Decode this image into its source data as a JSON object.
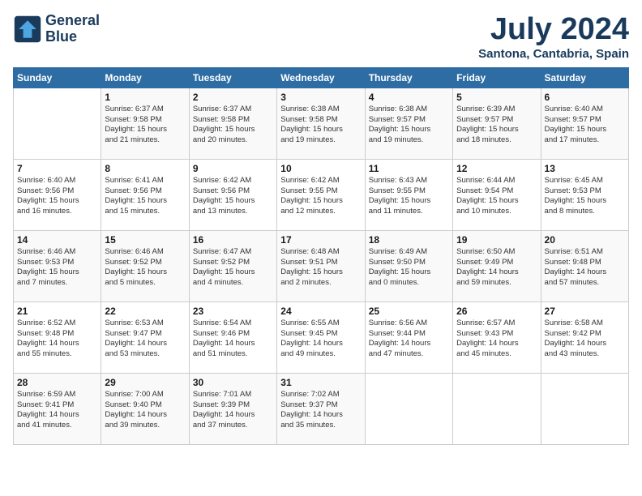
{
  "header": {
    "logo_line1": "General",
    "logo_line2": "Blue",
    "month_title": "July 2024",
    "location": "Santona, Cantabria, Spain"
  },
  "weekdays": [
    "Sunday",
    "Monday",
    "Tuesday",
    "Wednesday",
    "Thursday",
    "Friday",
    "Saturday"
  ],
  "weeks": [
    [
      {
        "day": "",
        "content": ""
      },
      {
        "day": "1",
        "content": "Sunrise: 6:37 AM\nSunset: 9:58 PM\nDaylight: 15 hours\nand 21 minutes."
      },
      {
        "day": "2",
        "content": "Sunrise: 6:37 AM\nSunset: 9:58 PM\nDaylight: 15 hours\nand 20 minutes."
      },
      {
        "day": "3",
        "content": "Sunrise: 6:38 AM\nSunset: 9:58 PM\nDaylight: 15 hours\nand 19 minutes."
      },
      {
        "day": "4",
        "content": "Sunrise: 6:38 AM\nSunset: 9:57 PM\nDaylight: 15 hours\nand 19 minutes."
      },
      {
        "day": "5",
        "content": "Sunrise: 6:39 AM\nSunset: 9:57 PM\nDaylight: 15 hours\nand 18 minutes."
      },
      {
        "day": "6",
        "content": "Sunrise: 6:40 AM\nSunset: 9:57 PM\nDaylight: 15 hours\nand 17 minutes."
      }
    ],
    [
      {
        "day": "7",
        "content": "Sunrise: 6:40 AM\nSunset: 9:56 PM\nDaylight: 15 hours\nand 16 minutes."
      },
      {
        "day": "8",
        "content": "Sunrise: 6:41 AM\nSunset: 9:56 PM\nDaylight: 15 hours\nand 15 minutes."
      },
      {
        "day": "9",
        "content": "Sunrise: 6:42 AM\nSunset: 9:56 PM\nDaylight: 15 hours\nand 13 minutes."
      },
      {
        "day": "10",
        "content": "Sunrise: 6:42 AM\nSunset: 9:55 PM\nDaylight: 15 hours\nand 12 minutes."
      },
      {
        "day": "11",
        "content": "Sunrise: 6:43 AM\nSunset: 9:55 PM\nDaylight: 15 hours\nand 11 minutes."
      },
      {
        "day": "12",
        "content": "Sunrise: 6:44 AM\nSunset: 9:54 PM\nDaylight: 15 hours\nand 10 minutes."
      },
      {
        "day": "13",
        "content": "Sunrise: 6:45 AM\nSunset: 9:53 PM\nDaylight: 15 hours\nand 8 minutes."
      }
    ],
    [
      {
        "day": "14",
        "content": "Sunrise: 6:46 AM\nSunset: 9:53 PM\nDaylight: 15 hours\nand 7 minutes."
      },
      {
        "day": "15",
        "content": "Sunrise: 6:46 AM\nSunset: 9:52 PM\nDaylight: 15 hours\nand 5 minutes."
      },
      {
        "day": "16",
        "content": "Sunrise: 6:47 AM\nSunset: 9:52 PM\nDaylight: 15 hours\nand 4 minutes."
      },
      {
        "day": "17",
        "content": "Sunrise: 6:48 AM\nSunset: 9:51 PM\nDaylight: 15 hours\nand 2 minutes."
      },
      {
        "day": "18",
        "content": "Sunrise: 6:49 AM\nSunset: 9:50 PM\nDaylight: 15 hours\nand 0 minutes."
      },
      {
        "day": "19",
        "content": "Sunrise: 6:50 AM\nSunset: 9:49 PM\nDaylight: 14 hours\nand 59 minutes."
      },
      {
        "day": "20",
        "content": "Sunrise: 6:51 AM\nSunset: 9:48 PM\nDaylight: 14 hours\nand 57 minutes."
      }
    ],
    [
      {
        "day": "21",
        "content": "Sunrise: 6:52 AM\nSunset: 9:48 PM\nDaylight: 14 hours\nand 55 minutes."
      },
      {
        "day": "22",
        "content": "Sunrise: 6:53 AM\nSunset: 9:47 PM\nDaylight: 14 hours\nand 53 minutes."
      },
      {
        "day": "23",
        "content": "Sunrise: 6:54 AM\nSunset: 9:46 PM\nDaylight: 14 hours\nand 51 minutes."
      },
      {
        "day": "24",
        "content": "Sunrise: 6:55 AM\nSunset: 9:45 PM\nDaylight: 14 hours\nand 49 minutes."
      },
      {
        "day": "25",
        "content": "Sunrise: 6:56 AM\nSunset: 9:44 PM\nDaylight: 14 hours\nand 47 minutes."
      },
      {
        "day": "26",
        "content": "Sunrise: 6:57 AM\nSunset: 9:43 PM\nDaylight: 14 hours\nand 45 minutes."
      },
      {
        "day": "27",
        "content": "Sunrise: 6:58 AM\nSunset: 9:42 PM\nDaylight: 14 hours\nand 43 minutes."
      }
    ],
    [
      {
        "day": "28",
        "content": "Sunrise: 6:59 AM\nSunset: 9:41 PM\nDaylight: 14 hours\nand 41 minutes."
      },
      {
        "day": "29",
        "content": "Sunrise: 7:00 AM\nSunset: 9:40 PM\nDaylight: 14 hours\nand 39 minutes."
      },
      {
        "day": "30",
        "content": "Sunrise: 7:01 AM\nSunset: 9:39 PM\nDaylight: 14 hours\nand 37 minutes."
      },
      {
        "day": "31",
        "content": "Sunrise: 7:02 AM\nSunset: 9:37 PM\nDaylight: 14 hours\nand 35 minutes."
      },
      {
        "day": "",
        "content": ""
      },
      {
        "day": "",
        "content": ""
      },
      {
        "day": "",
        "content": ""
      }
    ]
  ]
}
